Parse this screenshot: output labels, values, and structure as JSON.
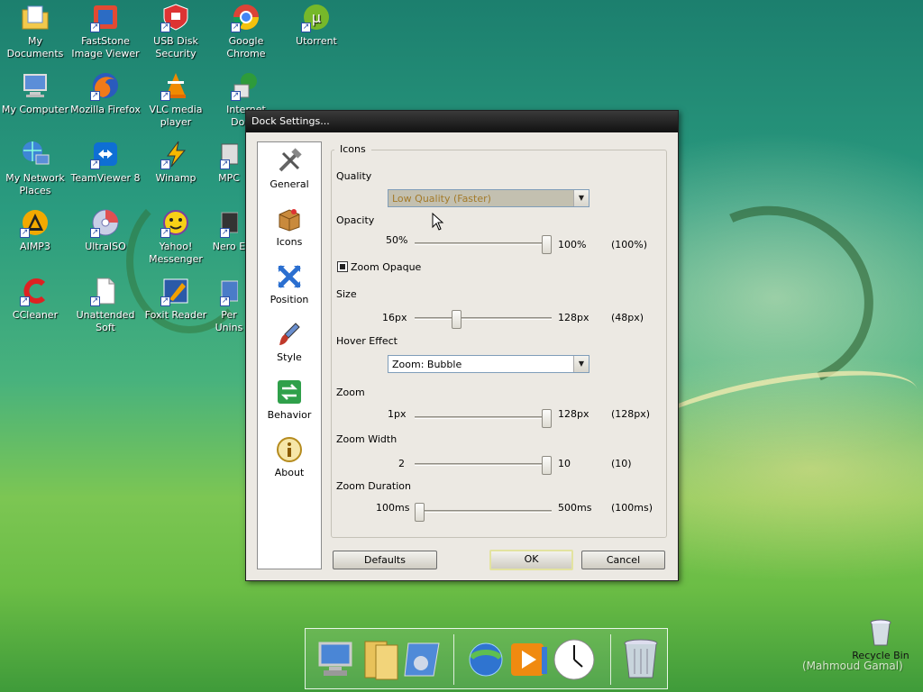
{
  "desktop": {
    "icons": [
      {
        "label": "My Documents",
        "icon": "folder-docs-icon",
        "shortcut": false
      },
      {
        "label": "FastStone Image Viewer",
        "icon": "faststone-icon",
        "shortcut": true
      },
      {
        "label": "USB Disk Security",
        "icon": "usb-security-icon",
        "shortcut": true
      },
      {
        "label": "Google Chrome",
        "icon": "chrome-icon",
        "shortcut": true
      },
      {
        "label": "Utorrent",
        "icon": "utorrent-icon",
        "shortcut": true
      },
      {
        "label": "My Computer",
        "icon": "computer-icon",
        "shortcut": false
      },
      {
        "label": "Mozilla Firefox",
        "icon": "firefox-icon",
        "shortcut": true
      },
      {
        "label": "VLC media player",
        "icon": "vlc-icon",
        "shortcut": true
      },
      {
        "label": "Internet Dow...",
        "icon": "idm-icon",
        "shortcut": true
      },
      {
        "label": "My Network Places",
        "icon": "network-icon",
        "shortcut": false
      },
      {
        "label": "TeamViewer 8",
        "icon": "teamviewer-icon",
        "shortcut": true
      },
      {
        "label": "Winamp",
        "icon": "winamp-icon",
        "shortcut": true
      },
      {
        "label": "MPC",
        "icon": "mpc-icon",
        "shortcut": true
      },
      {
        "label": "AIMP3",
        "icon": "aimp-icon",
        "shortcut": true
      },
      {
        "label": "UltraISO",
        "icon": "ultraiso-icon",
        "shortcut": true
      },
      {
        "label": "Yahoo! Messenger",
        "icon": "yahoo-icon",
        "shortcut": true
      },
      {
        "label": "Nero E",
        "icon": "nero-icon",
        "shortcut": true
      },
      {
        "label": "CCleaner",
        "icon": "ccleaner-icon",
        "shortcut": true
      },
      {
        "label": "Unattended Soft",
        "icon": "file-icon",
        "shortcut": true
      },
      {
        "label": "Foxit Reader",
        "icon": "foxit-icon",
        "shortcut": true
      },
      {
        "label": "Per Unins",
        "icon": "uninstaller-icon",
        "shortcut": true
      }
    ],
    "recycle_bin_label": "Recycle Bin",
    "watermark": "(Mahmoud Gamal)"
  },
  "dialog": {
    "title": "Dock Settings...",
    "nav": [
      {
        "label": "General",
        "icon": "tools-icon"
      },
      {
        "label": "Icons",
        "icon": "box-icon"
      },
      {
        "label": "Position",
        "icon": "move-arrows-icon"
      },
      {
        "label": "Style",
        "icon": "brush-icon"
      },
      {
        "label": "Behavior",
        "icon": "switch-arrows-icon"
      },
      {
        "label": "About",
        "icon": "info-icon"
      }
    ],
    "group_title": "Icons",
    "quality": {
      "label": "Quality",
      "value": "Low Quality (Faster)"
    },
    "opacity": {
      "label": "Opacity",
      "min": "50%",
      "max": "100%",
      "current": "(100%)",
      "level": 1.0
    },
    "zoom_opaque": {
      "label": "Zoom Opaque",
      "checked": true
    },
    "size": {
      "label": "Size",
      "min": "16px",
      "max": "128px",
      "current": "(48px)",
      "level": 0.29
    },
    "hover_effect": {
      "label": "Hover Effect",
      "value": "Zoom: Bubble"
    },
    "zoom": {
      "label": "Zoom",
      "min": "1px",
      "max": "128px",
      "current": "(128px)",
      "level": 1.0
    },
    "zoom_width": {
      "label": "Zoom Width",
      "min": "2",
      "max": "10",
      "current": "(10)",
      "level": 1.0
    },
    "zoom_duration": {
      "label": "Zoom Duration",
      "min": "100ms",
      "max": "500ms",
      "current": "(100ms)",
      "level": 0.0
    },
    "buttons": {
      "defaults": "Defaults",
      "ok": "OK",
      "cancel": "Cancel"
    }
  },
  "dock": {
    "items": [
      {
        "icon": "computer-icon"
      },
      {
        "icon": "folders-icon"
      },
      {
        "icon": "control-panel-icon"
      },
      {
        "icon": "internet-explorer-icon"
      },
      {
        "icon": "media-player-icon"
      },
      {
        "icon": "clock-icon"
      },
      {
        "icon": "recycle-bin-icon"
      }
    ]
  },
  "colors": {
    "title_bar": "#111111",
    "dialog_bg": "#ece9e3",
    "desktop_green": "#48b27d",
    "disabled_text": "#a37a2a"
  }
}
